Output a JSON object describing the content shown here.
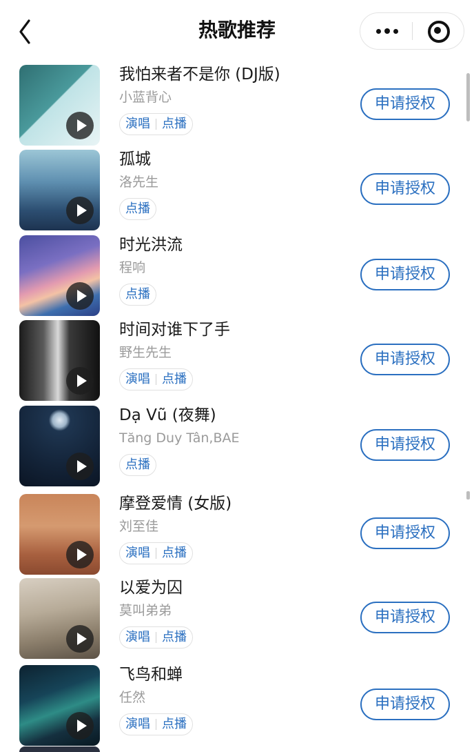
{
  "nav": {
    "title": "热歌推荐",
    "back_icon": "chevron-left-icon",
    "more_icon": "more-dots-icon",
    "close_icon": "close-circle-icon"
  },
  "action_label": "申请授权",
  "tag_labels": {
    "sing": "演唱",
    "play": "点播"
  },
  "colors": {
    "accent": "#2a6fc0",
    "muted_text": "#9a9a9a"
  },
  "songs": [
    {
      "name": "我怕来者不是你 (DJ版)",
      "artist": "小蓝背心",
      "tags": [
        "演唱",
        "点播"
      ]
    },
    {
      "name": "孤城",
      "artist": "洛先生",
      "tags": [
        "点播"
      ]
    },
    {
      "name": "时光洪流",
      "artist": "程响",
      "tags": [
        "点播"
      ]
    },
    {
      "name": "时间对谁下了手",
      "artist": "野生先生",
      "tags": [
        "演唱",
        "点播"
      ]
    },
    {
      "name": "Dạ Vũ (夜舞)",
      "artist": "Tăng Duy Tân,BAE",
      "tags": [
        "点播"
      ]
    },
    {
      "name": "摩登爱情 (女版)",
      "artist": "刘至佳",
      "tags": [
        "演唱",
        "点播"
      ]
    },
    {
      "name": "以爱为囚",
      "artist": "莫叫弟弟",
      "tags": [
        "演唱",
        "点播"
      ]
    },
    {
      "name": "飞鸟和蝉",
      "artist": "任然",
      "tags": [
        "演唱",
        "点播"
      ]
    }
  ]
}
